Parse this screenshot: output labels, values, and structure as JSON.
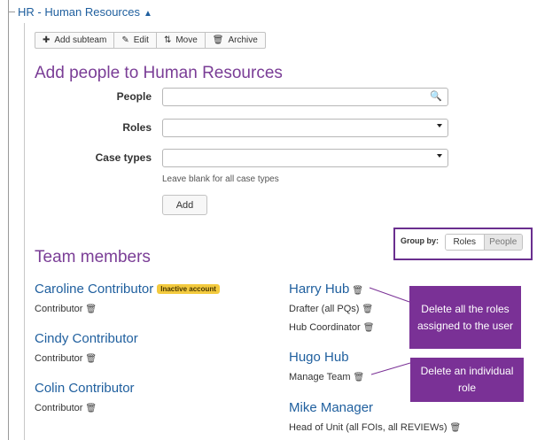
{
  "breadcrumb": {
    "label": "HR - Human Resources",
    "caret": "▲"
  },
  "toolbar": {
    "add_subteam": "Add subteam",
    "edit": "Edit",
    "move": "Move",
    "archive": "Archive"
  },
  "form": {
    "title": "Add people to Human Resources",
    "people_label": "People",
    "people_value": "",
    "roles_label": "Roles",
    "roles_value": "",
    "casetypes_label": "Case types",
    "casetypes_value": "",
    "hint": "Leave blank for all case types",
    "add_button": "Add"
  },
  "group_by": {
    "label": "Group by:",
    "options": [
      "Roles",
      "People"
    ],
    "selected": "Roles"
  },
  "team": {
    "title": "Team members",
    "left": [
      {
        "name": "Caroline Contributor",
        "badge": "Inactive account",
        "roles": [
          "Contributor"
        ]
      },
      {
        "name": "Cindy Contributor",
        "roles": [
          "Contributor"
        ]
      },
      {
        "name": "Colin Contributor",
        "roles": [
          "Contributor"
        ]
      }
    ],
    "right": [
      {
        "name": "Harry Hub",
        "roles": [
          "Drafter (all PQs)",
          "Hub Coordinator"
        ]
      },
      {
        "name": "Hugo Hub",
        "roles": [
          "Manage Team"
        ]
      },
      {
        "name": "Mike Manager",
        "roles": [
          "Head of Unit (all FOIs, all REVIEWs)"
        ]
      }
    ]
  },
  "callouts": {
    "delete_all": "Delete all the roles assigned to the user",
    "delete_one": "Delete an individual role"
  },
  "colors": {
    "accent_purple": "#7a3d96",
    "link_blue": "#1f5f9e",
    "callout_bg": "#7a3196",
    "badge_yellow": "#f3ca3e"
  },
  "icons": {
    "plus": "plus-icon",
    "pencil": "pencil-icon",
    "sort": "sort-icon",
    "trash": "trash-icon",
    "search": "search-icon"
  }
}
